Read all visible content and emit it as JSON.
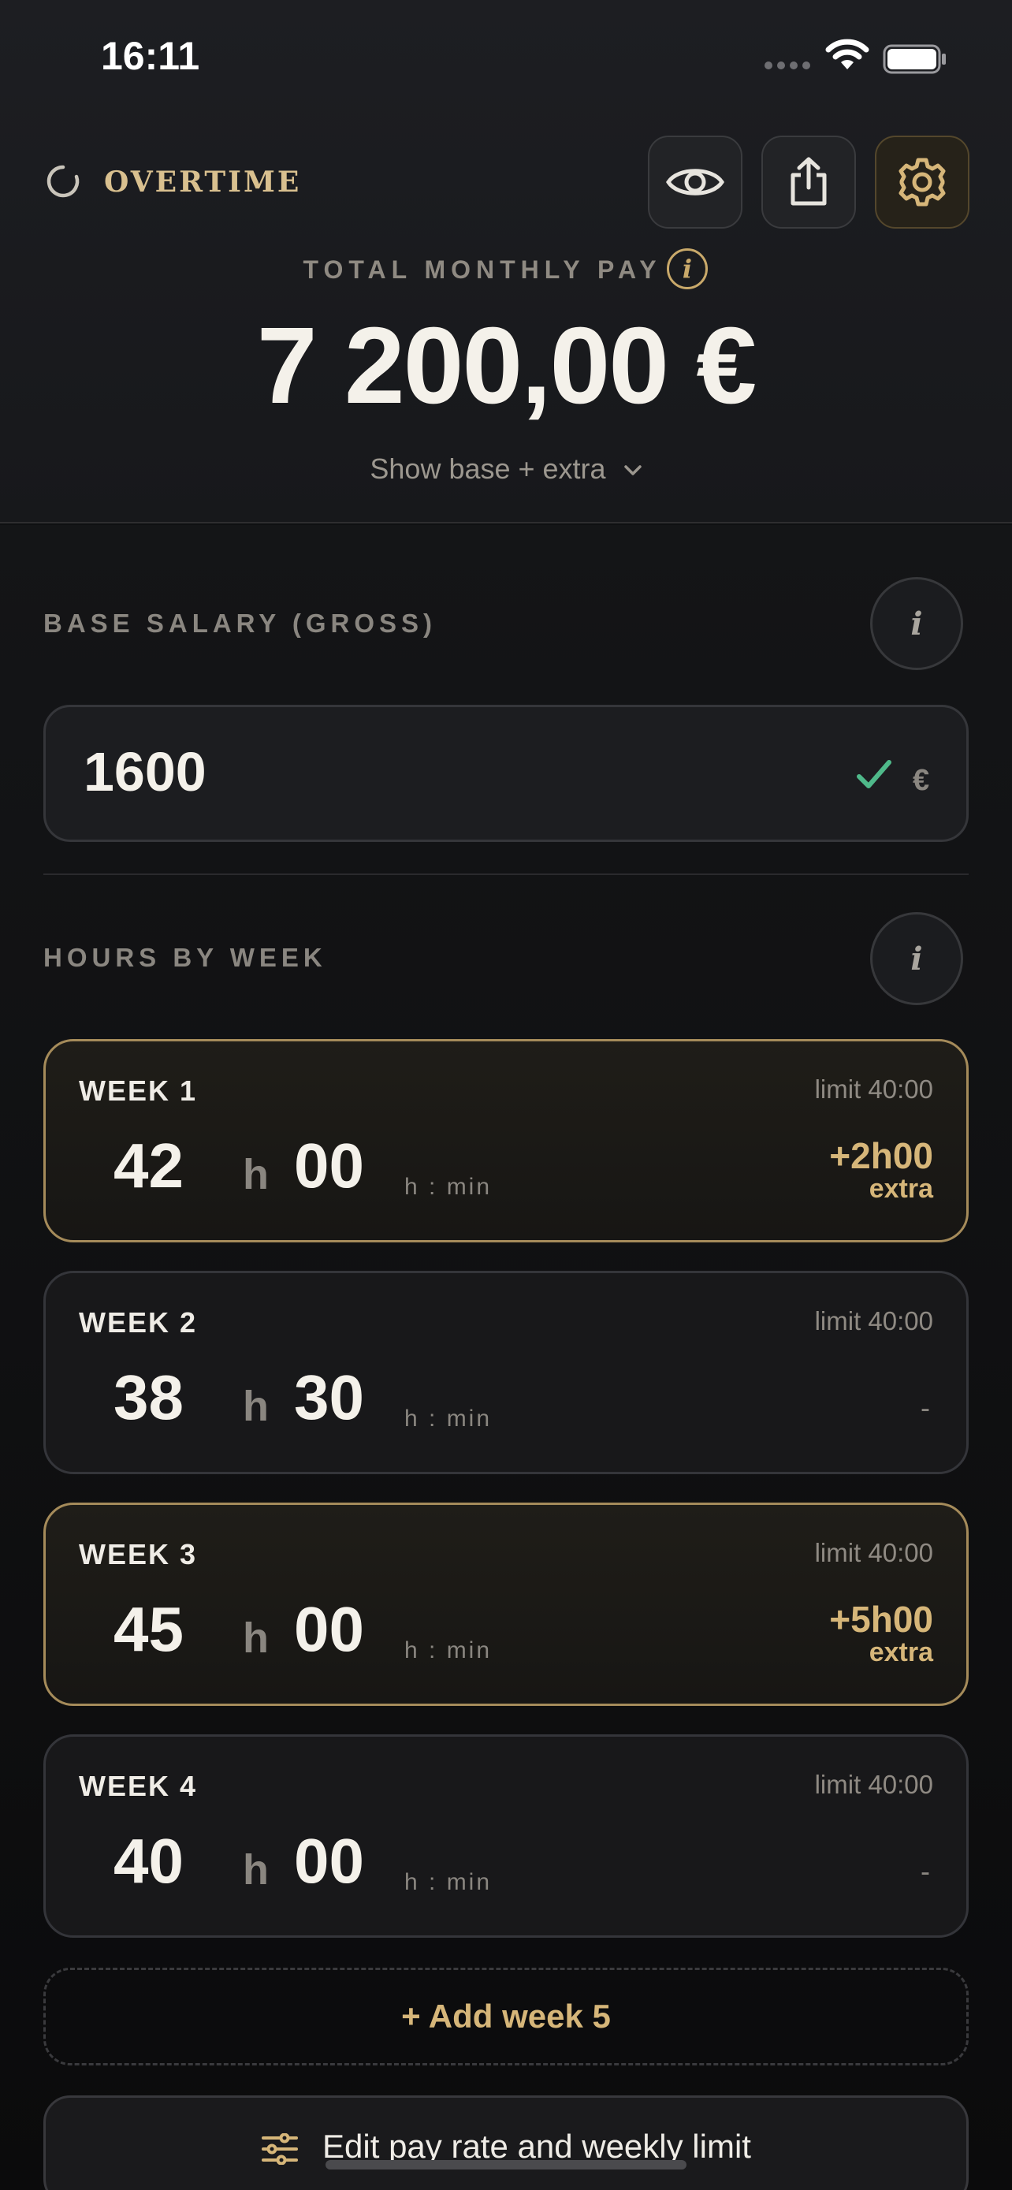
{
  "status_bar": {
    "time": "16:11"
  },
  "header": {
    "brand": "OVERTIME",
    "buttons": [
      "eye-icon",
      "share-icon",
      "gear-icon"
    ],
    "total_label": "TOTAL MONTHLY PAY",
    "total_info": "i",
    "total_amount": "7 200,00 €",
    "show_base_toggle": "Show base + extra"
  },
  "salary": {
    "label": "BASE SALARY (GROSS)",
    "info": "i",
    "value": "1600",
    "currency": "€"
  },
  "hours": {
    "label": "HOURS BY WEEK",
    "info": "i",
    "unit": "h : min",
    "hour_sep": "h",
    "weeks": [
      {
        "title": "WEEK 1",
        "limit": "limit 40:00",
        "hours": "42",
        "minutes": "00",
        "extra": "+2h00",
        "extra_label": "extra",
        "has_extra": true
      },
      {
        "title": "WEEK 2",
        "limit": "limit 40:00",
        "hours": "38",
        "minutes": "30",
        "extra": "-",
        "has_extra": false
      },
      {
        "title": "WEEK 3",
        "limit": "limit 40:00",
        "hours": "45",
        "minutes": "00",
        "extra": "+5h00",
        "extra_label": "extra",
        "has_extra": true
      },
      {
        "title": "WEEK 4",
        "limit": "limit 40:00",
        "hours": "40",
        "minutes": "00",
        "extra": "-",
        "has_extra": false
      }
    ],
    "add_week": "+ Add week 5"
  },
  "edit_rate": "Edit pay rate and weekly limit",
  "colors": {
    "accent_gold": "#d6b679",
    "check_green": "#4fb98a",
    "background": "#0f1012"
  }
}
